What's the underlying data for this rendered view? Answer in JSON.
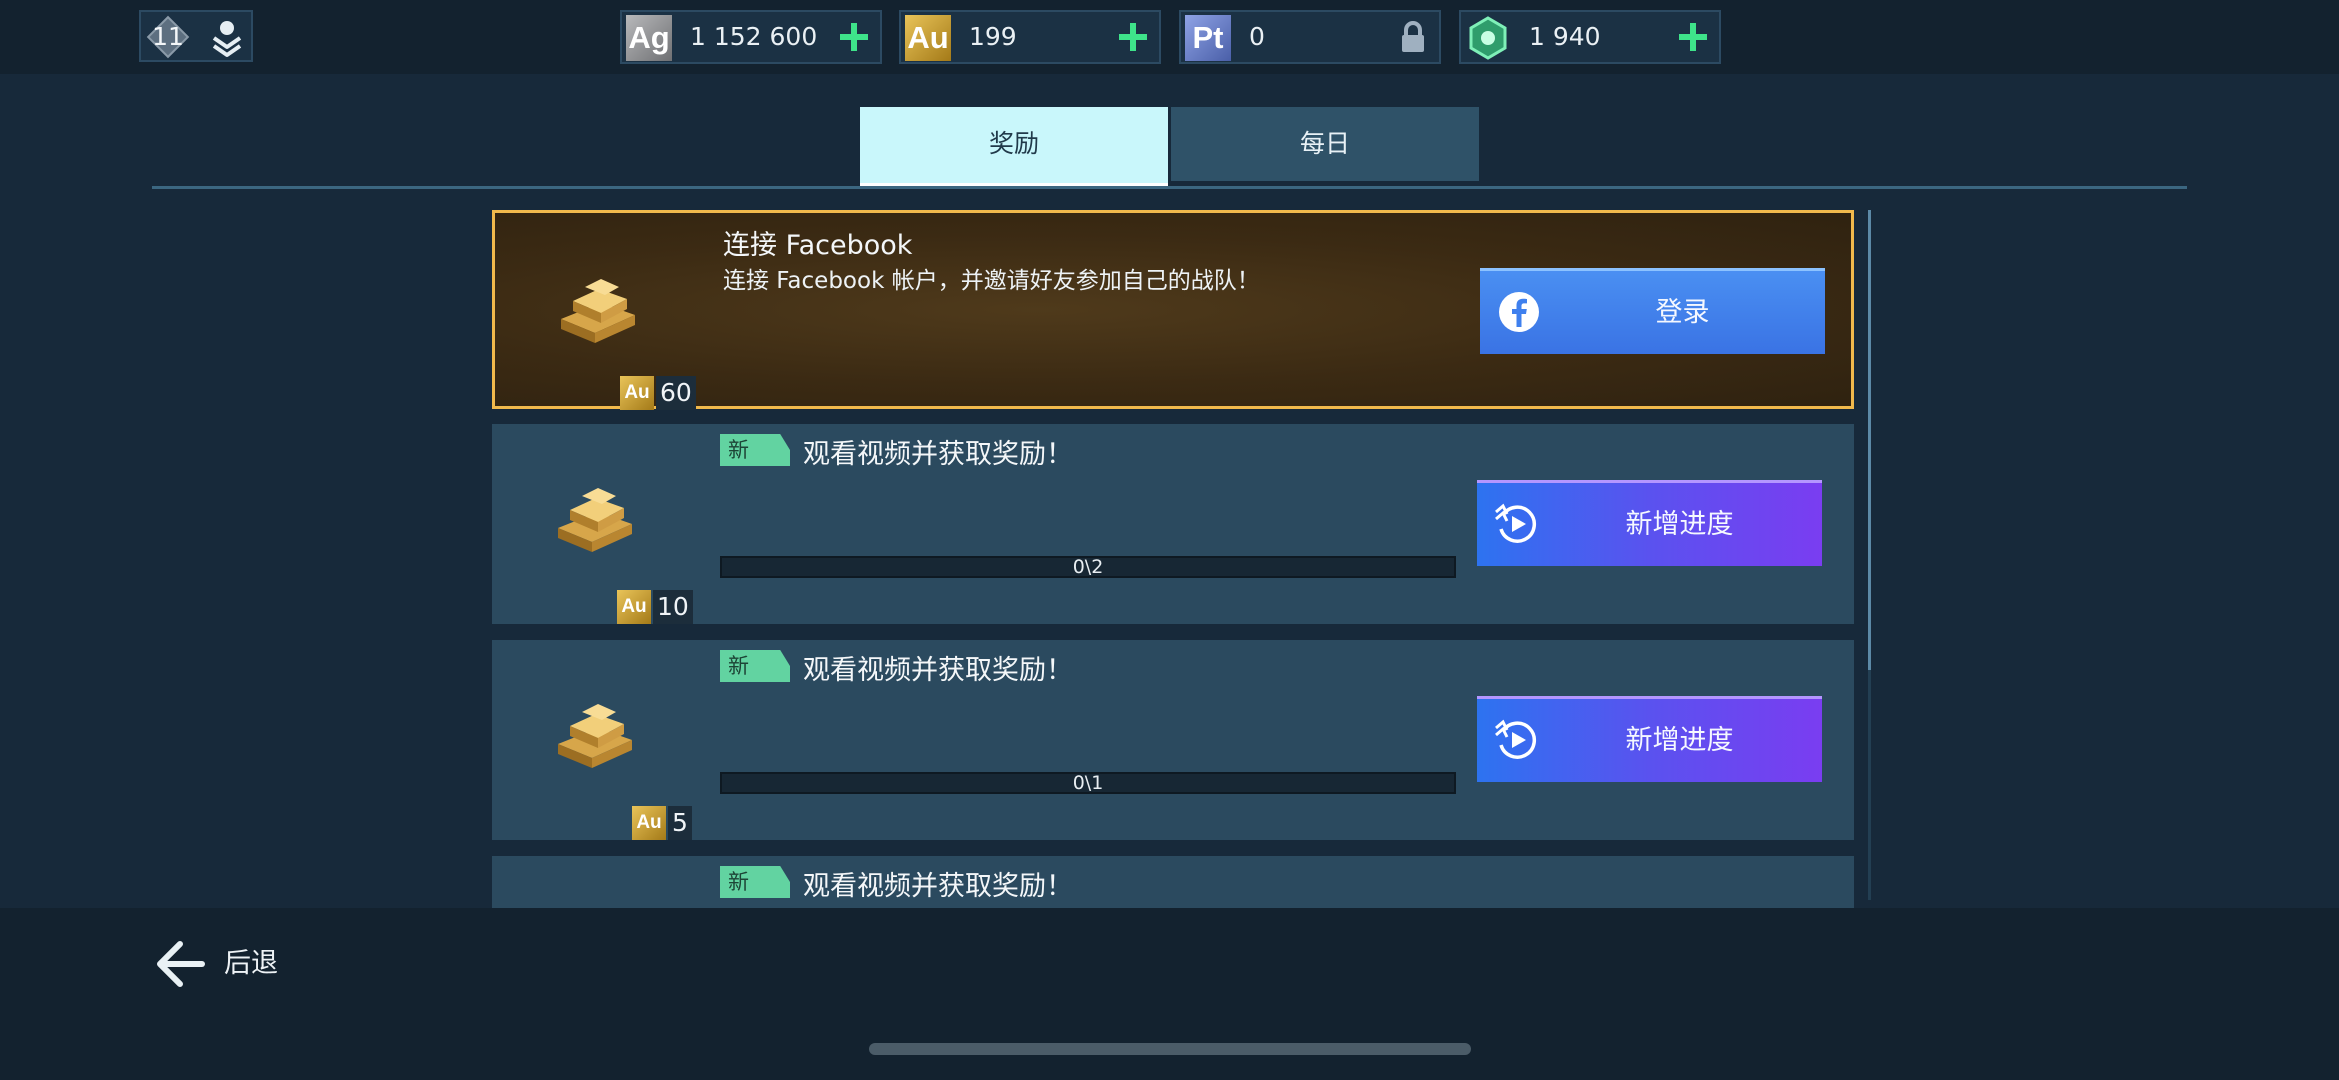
{
  "topbar": {
    "level": "11",
    "profile_icon": "user-download-icon",
    "currencies": [
      {
        "code": "Ag",
        "value": "1 152 600",
        "action_icon": "plus-icon",
        "color": "#8e8f92"
      },
      {
        "code": "Au",
        "value": "199",
        "action_icon": "plus-icon",
        "color": "#d2a530"
      },
      {
        "code": "Pt",
        "value": "0",
        "action_icon": "lock-icon",
        "color": "#6d82c7"
      },
      {
        "code": "",
        "value": "1 940",
        "action_icon": "plus-icon",
        "color": "#3fd18a"
      }
    ]
  },
  "tabs": [
    {
      "label": "奖励",
      "active": true
    },
    {
      "label": "每日",
      "active": false
    }
  ],
  "tasks": [
    {
      "title": "连接 Facebook",
      "description": "连接 Facebook 帐户，并邀请好友参加自己的战队！",
      "reward": "60",
      "reward_currency": "Au",
      "button": "登录",
      "button_icon": "facebook-icon"
    },
    {
      "tag": "新",
      "title": "观看视频并获取奖励！",
      "progress_text": "0\\2",
      "progress": 0,
      "reward": "10",
      "reward_currency": "Au",
      "button": "新增进度",
      "button_icon": "play-refresh-icon"
    },
    {
      "tag": "新",
      "title": "观看视频并获取奖励！",
      "progress_text": "0\\1",
      "progress": 0,
      "reward": "5",
      "reward_currency": "Au",
      "button": "新增进度",
      "button_icon": "play-refresh-icon"
    },
    {
      "tag": "新",
      "title": "观看视频并获取奖励！"
    }
  ],
  "footer": {
    "back_label": "后退",
    "back_icon": "arrow-left-icon"
  },
  "colors": {
    "accent_gold": "#f1b94c",
    "tab_active": "#c9f7fb",
    "new_tag": "#62d3a1",
    "fb_button": "#4a8ff2"
  }
}
